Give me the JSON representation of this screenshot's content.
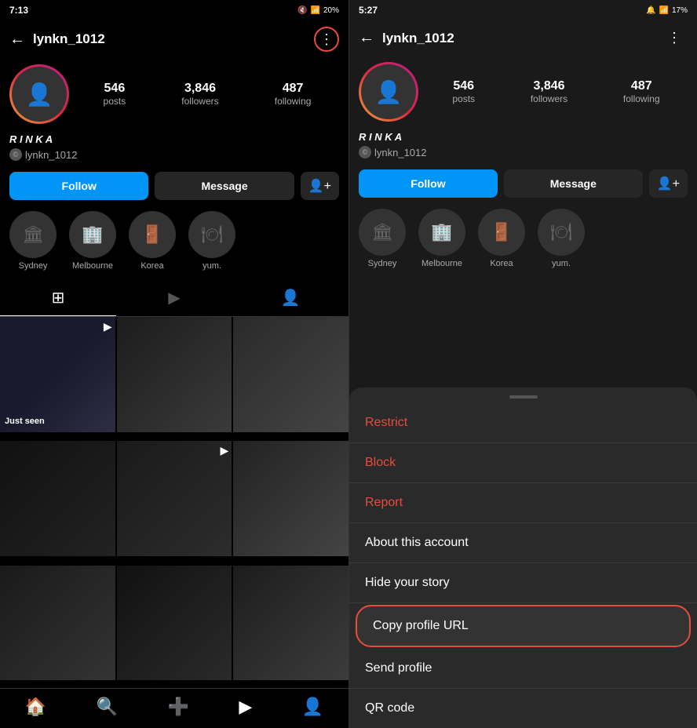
{
  "left": {
    "status": {
      "time": "7:13",
      "icons": "🔋📶"
    },
    "header": {
      "back": "←",
      "username": "lynkn_1012",
      "menu": "⋮"
    },
    "stats": {
      "posts_num": "546",
      "posts_label": "posts",
      "followers_num": "3,846",
      "followers_label": "followers",
      "following_num": "487",
      "following_label": "following"
    },
    "profile": {
      "name": "R I N K A",
      "handle": "lynkn_1012"
    },
    "buttons": {
      "follow": "Follow",
      "message": "Message",
      "add": "👤+"
    },
    "highlights": [
      {
        "label": "Sydney"
      },
      {
        "label": "Melbourne"
      },
      {
        "label": "Korea"
      },
      {
        "label": "yum."
      }
    ],
    "tabs": {
      "grid": "⊞",
      "reels": "▶",
      "tagged": "👤"
    },
    "posts": [
      {
        "id": 1,
        "class": "pc1",
        "icon": "▶",
        "text": "Just seen"
      },
      {
        "id": 2,
        "class": "pc2",
        "icon": ""
      },
      {
        "id": 3,
        "class": "pc3",
        "icon": ""
      },
      {
        "id": 4,
        "class": "pc4",
        "icon": ""
      },
      {
        "id": 5,
        "class": "pc5",
        "icon": "▶"
      },
      {
        "id": 6,
        "class": "pc6",
        "icon": ""
      },
      {
        "id": 7,
        "class": "pc7",
        "icon": ""
      },
      {
        "id": 8,
        "class": "pc8",
        "icon": ""
      },
      {
        "id": 9,
        "class": "pc9",
        "icon": ""
      }
    ],
    "bottom_nav": [
      "🏠",
      "🔍",
      "➕",
      "▶",
      "👤"
    ]
  },
  "right": {
    "status": {
      "time": "5:27",
      "icons": "🔋📶"
    },
    "header": {
      "back": "←",
      "username": "lynkn_1012",
      "menu": "⋮"
    },
    "stats": {
      "posts_num": "546",
      "posts_label": "posts",
      "followers_num": "3,846",
      "followers_label": "followers",
      "following_num": "487",
      "following_label": "following"
    },
    "profile": {
      "name": "R I N K A",
      "handle": "lynkn_1012"
    },
    "buttons": {
      "follow": "Follow",
      "message": "Message",
      "add": "👤+"
    },
    "highlights": [
      {
        "label": "Sydney"
      },
      {
        "label": "Melbourne"
      },
      {
        "label": "Korea"
      },
      {
        "label": "yum."
      }
    ],
    "sheet": {
      "items": [
        {
          "text": "Restrict",
          "class": "red"
        },
        {
          "text": "Block",
          "class": "red"
        },
        {
          "text": "Report",
          "class": "red"
        },
        {
          "text": "About this account",
          "class": ""
        },
        {
          "text": "Hide your story",
          "class": ""
        },
        {
          "text": "Copy profile URL",
          "class": "highlighted"
        },
        {
          "text": "Send profile",
          "class": ""
        },
        {
          "text": "QR code",
          "class": ""
        }
      ]
    }
  }
}
